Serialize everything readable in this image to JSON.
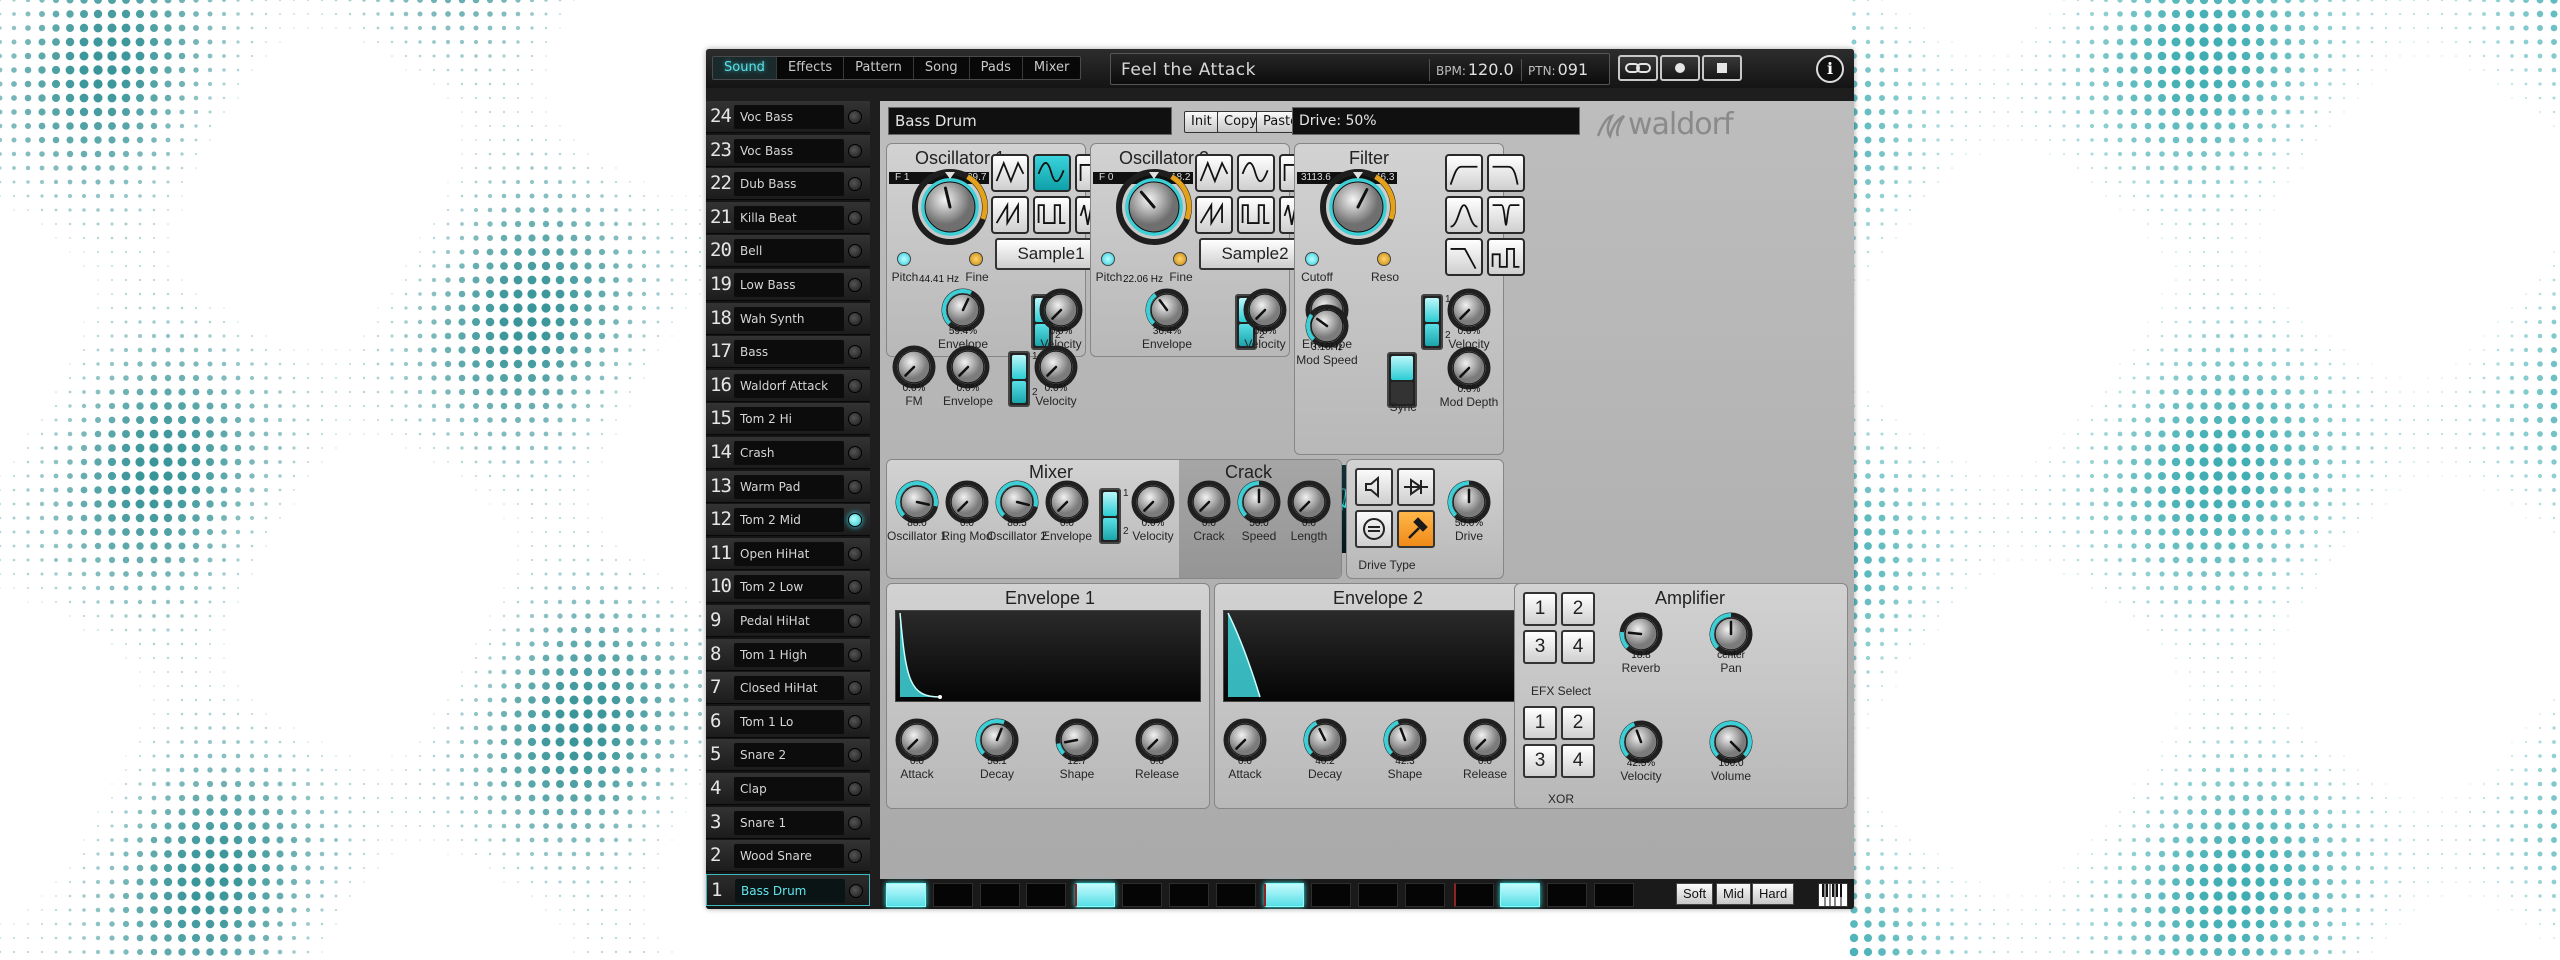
{
  "tabs": [
    "Sound",
    "Effects",
    "Pattern",
    "Song",
    "Pads",
    "Mixer"
  ],
  "active_tab": "Sound",
  "header": {
    "song_title": "Feel the Attack",
    "bpm_label": "BPM",
    "bpm_value": "120.0",
    "ptn_label": "PTN",
    "ptn_value": "091",
    "info": "i"
  },
  "sounds": [
    {
      "num": "24",
      "name": "Voc Bass"
    },
    {
      "num": "23",
      "name": "Voc Bass"
    },
    {
      "num": "22",
      "name": "Dub Bass"
    },
    {
      "num": "21",
      "name": "Killa Beat"
    },
    {
      "num": "20",
      "name": "Bell"
    },
    {
      "num": "19",
      "name": "Low Bass"
    },
    {
      "num": "18",
      "name": "Wah Synth"
    },
    {
      "num": "17",
      "name": "Bass"
    },
    {
      "num": "16",
      "name": "Waldorf Attack"
    },
    {
      "num": "15",
      "name": "Tom 2 Hi"
    },
    {
      "num": "14",
      "name": "Crash"
    },
    {
      "num": "13",
      "name": "Warm Pad"
    },
    {
      "num": "12",
      "name": "Tom 2 Mid",
      "led_on": true
    },
    {
      "num": "11",
      "name": "Open HiHat"
    },
    {
      "num": "10",
      "name": "Tom 2 Low"
    },
    {
      "num": "9",
      "name": "Pedal HiHat"
    },
    {
      "num": "8",
      "name": "Tom 1 High"
    },
    {
      "num": "7",
      "name": "Closed HiHat"
    },
    {
      "num": "6",
      "name": "Tom 1 Lo"
    },
    {
      "num": "5",
      "name": "Snare 2"
    },
    {
      "num": "4",
      "name": "Clap"
    },
    {
      "num": "3",
      "name": "Snare 1"
    },
    {
      "num": "2",
      "name": "Wood Snare"
    },
    {
      "num": "1",
      "name": "Bass Drum",
      "selected": true
    }
  ],
  "sound_name": "Bass Drum",
  "edit_buttons": {
    "init": "Init",
    "copy": "Copy",
    "paste": "Paste"
  },
  "param_display": "Drive: 50%",
  "brand": "waldorf",
  "osc1": {
    "title": "Oscillator 1",
    "range_min": "F 1",
    "range_max": "29.7",
    "freq": "44.41 Hz",
    "pitch_label": "Pitch",
    "fine_label": "Fine",
    "sample": "Sample1",
    "env": {
      "value": "59.4%",
      "label": "Envelope"
    },
    "vel": {
      "value": "0.0%",
      "label": "Velocity"
    },
    "toggle": [
      "1",
      "2"
    ]
  },
  "osc2": {
    "title": "Oscillator 2",
    "range_min": "F 0",
    "range_max": "18.2",
    "freq": "22.06 Hz",
    "pitch_label": "Pitch",
    "fine_label": "Fine",
    "sample": "Sample2",
    "env": {
      "value": "36.4%",
      "label": "Envelope"
    },
    "vel": {
      "value": "0.0%",
      "label": "Velocity"
    },
    "toggle": [
      "1",
      "2"
    ]
  },
  "fm_row": {
    "fm": {
      "value": "0.0%",
      "label": "FM"
    },
    "env": {
      "value": "0.0%",
      "label": "Envelope"
    },
    "vel": {
      "value": "0.0%",
      "label": "Velocity"
    },
    "toggle": [
      "1",
      "2"
    ]
  },
  "filter": {
    "title": "Filter",
    "range_min": "3113.6",
    "range_max": "46.3",
    "cutoff_label": "Cutoff",
    "reso_label": "Reso",
    "env": {
      "value": "0.0%",
      "label": "Envelope"
    },
    "vel": {
      "value": "0.0%",
      "label": "Velocity"
    },
    "mod_speed": {
      "value": "3.16Hz",
      "label": "Mod Speed"
    },
    "sync_label": "Sync",
    "mod_depth": {
      "value": "0.0%",
      "label": "Mod Depth"
    },
    "toggle": [
      "1",
      "2"
    ]
  },
  "mixer": {
    "title": "Mixer",
    "knobs": [
      {
        "value": "88.0",
        "label": "Oscillator 1",
        "level": 0.88
      },
      {
        "value": "0.0",
        "label": "Ring Mod",
        "level": 0
      },
      {
        "value": "88.5",
        "label": "Oscillator 2",
        "level": 0.885
      },
      {
        "value": "0.0",
        "label": "Envelope",
        "level": 0
      }
    ],
    "vel": {
      "value": "0.0%",
      "label": "Velocity"
    },
    "toggle": [
      "1",
      "2"
    ]
  },
  "crack": {
    "title": "Crack",
    "knobs": [
      {
        "value": "0.0",
        "label": "Crack",
        "level": 0
      },
      {
        "value": "50.0",
        "label": "Speed",
        "level": 0.5
      },
      {
        "value": "0.0",
        "label": "Length",
        "level": 0
      }
    ]
  },
  "drive": {
    "type_label": "Drive Type",
    "value": "50.0%",
    "label": "Drive"
  },
  "env1": {
    "title": "Envelope 1",
    "knobs": [
      {
        "value": "0.0",
        "label": "Attack",
        "level": 0
      },
      {
        "value": "58.1",
        "label": "Decay",
        "level": 0.581
      },
      {
        "value": "12.7",
        "label": "Shape",
        "level": 0.127
      },
      {
        "value": "0.0",
        "label": "Release",
        "level": 0
      }
    ]
  },
  "env2": {
    "title": "Envelope 2",
    "knobs": [
      {
        "value": "0.0",
        "label": "Attack",
        "level": 0
      },
      {
        "value": "40.2",
        "label": "Decay",
        "level": 0.402
      },
      {
        "value": "42.3",
        "label": "Shape",
        "level": 0.423
      },
      {
        "value": "0.0",
        "label": "Release",
        "level": 0
      }
    ]
  },
  "amp": {
    "title": "Amplifier",
    "efx_buttons": [
      "1",
      "2",
      "3",
      "4"
    ],
    "efx_label": "EFX Select",
    "xor_buttons": [
      "1",
      "2",
      "3",
      "4"
    ],
    "xor_label": "XOR",
    "reverb": {
      "value": "18.8",
      "label": "Reverb"
    },
    "pan": {
      "value": "center",
      "label": "Pan"
    },
    "vel": {
      "value": "42.5%",
      "label": "Velocity"
    },
    "volume": {
      "value": "100.0",
      "label": "Volume"
    }
  },
  "sequencer": {
    "steps_on": [
      1,
      5,
      9,
      14
    ],
    "velocity_buttons": [
      "Soft",
      "Mid",
      "Hard"
    ]
  },
  "colors": {
    "accent": "#3ccfd6",
    "drive_active": "#f0901c",
    "panel": "#c4c4c4"
  }
}
